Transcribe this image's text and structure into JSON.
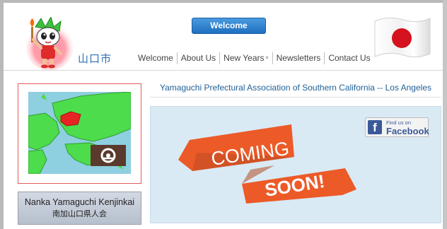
{
  "header": {
    "city_name": "山口市",
    "welcome_button": "Welcome",
    "nav": [
      {
        "label": "Welcome"
      },
      {
        "label": "About Us"
      },
      {
        "label": "New Years",
        "has_dropdown": true,
        "dropdown_marker": "˅"
      },
      {
        "label": "Newsletters"
      },
      {
        "label": "Contact Us"
      }
    ]
  },
  "main": {
    "title": "Yamaguchi Prefectural Association of Southern California -- Los Angeles",
    "banner": {
      "line1": "COMING",
      "line2": "SOON!"
    }
  },
  "sidebar": {
    "kenjinkai_en": "Nanka Yamaguchi Kenjinkai",
    "kenjinkai_jp": "南加山口県人会"
  },
  "facebook": {
    "letter": "f",
    "small": "Find us on",
    "big": "Facebook"
  },
  "colors": {
    "accent_blue": "#2f6fb6",
    "welcome_button": "#1e6fbe",
    "map_green": "#4ddc4b",
    "map_red": "#e82323",
    "banner_orange": "#ec5a28",
    "panel_bg": "#d9eaf5",
    "facebook_blue": "#3b5998"
  },
  "icons": {
    "mascot": "mascot-icon",
    "flag": "japan-flag-icon",
    "map": "japan-map-icon",
    "emblem": "yamaguchi-emblem-icon",
    "facebook": "facebook-icon"
  }
}
